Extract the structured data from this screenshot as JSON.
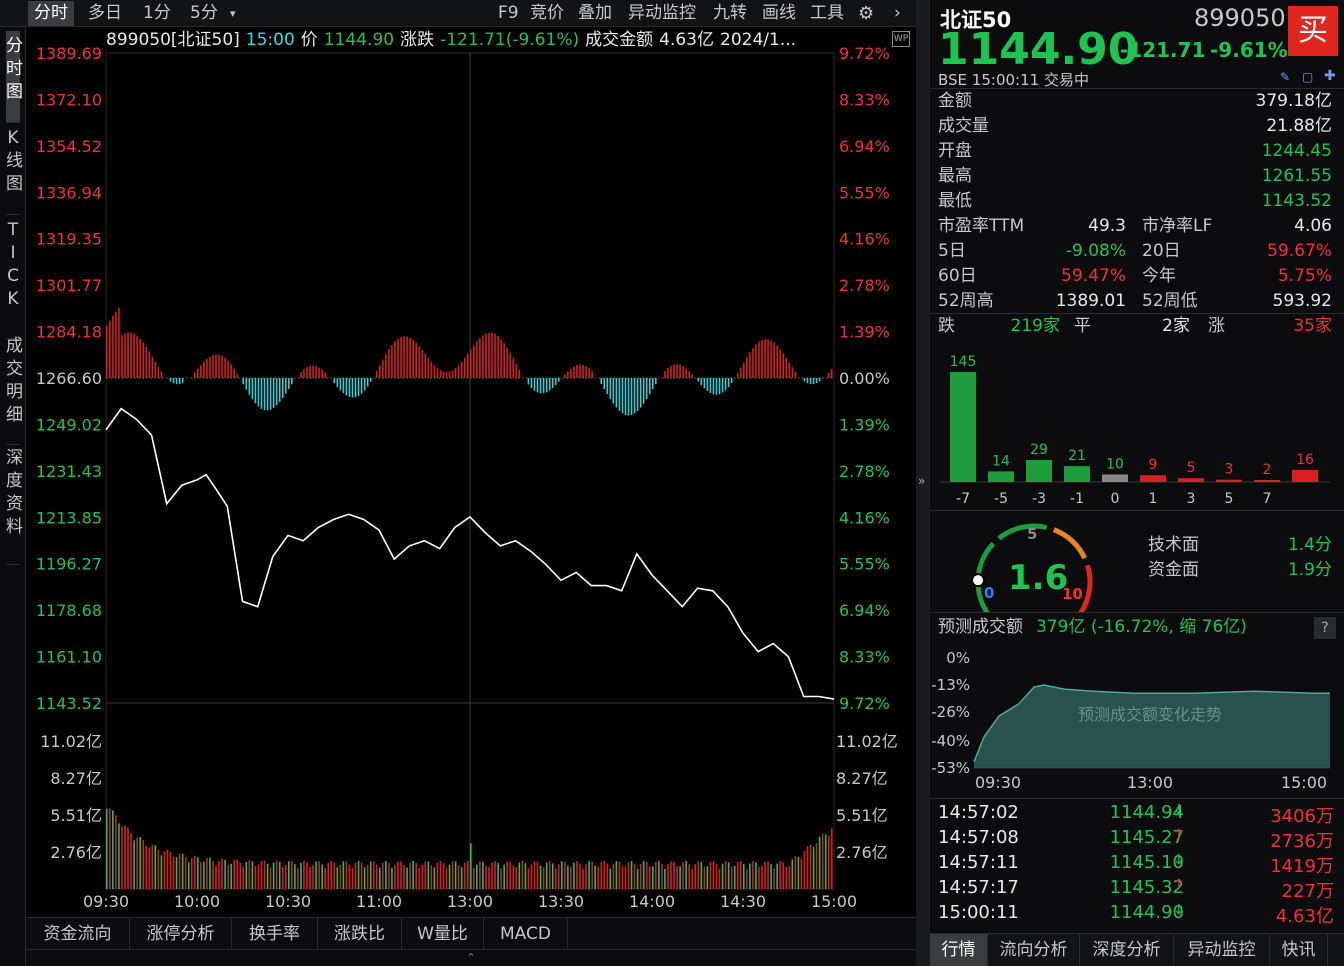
{
  "toolbar": {
    "tabs": [
      "分时",
      "多日",
      "1分",
      "5分"
    ],
    "tools": [
      "F9",
      "竞价",
      "叠加",
      "异动监控",
      "九转",
      "画线",
      "工具"
    ]
  },
  "left_tabs": [
    "分时图",
    "K线图",
    "TICK",
    "成交明细",
    "深度资料"
  ],
  "infobar": {
    "code": "899050[北证50]",
    "time": "15:00",
    "price_label": "价",
    "price": "1144.90",
    "change_label": "涨跌",
    "change": "-121.71(-9.61%)",
    "amount_label": "成交金额",
    "amount": "4.63亿",
    "date": "2024/1..."
  },
  "chart_data": {
    "type": "line",
    "title": "",
    "x_ticks": [
      "09:30",
      "10:00",
      "10:30",
      "11:00",
      "13:00",
      "13:30",
      "14:00",
      "14:30",
      "15:00"
    ],
    "price_ticks": [
      "1389.69",
      "1372.10",
      "1354.52",
      "1336.94",
      "1319.35",
      "1301.77",
      "1284.18",
      "1266.60",
      "1249.02",
      "1231.43",
      "1213.85",
      "1196.27",
      "1178.68",
      "1161.10",
      "1143.52"
    ],
    "pct_ticks": [
      "9.72%",
      "8.33%",
      "6.94%",
      "5.55%",
      "4.16%",
      "2.78%",
      "1.39%",
      "0.00%",
      "1.39%",
      "2.78%",
      "4.16%",
      "5.55%",
      "6.94%",
      "8.33%",
      "9.72%"
    ],
    "prev_close": 1266.6,
    "ylim": [
      1143.52,
      1389.69
    ],
    "volume_ticks": [
      "11.02亿",
      "8.27亿",
      "5.51亿",
      "2.76亿"
    ],
    "series": [
      {
        "x": [
          0,
          5,
          10,
          15,
          20,
          25,
          30,
          33,
          36,
          40,
          45,
          50,
          55,
          60,
          65,
          70,
          75,
          80,
          85,
          90,
          95,
          100,
          105,
          110,
          115,
          120,
          125,
          130,
          135,
          140,
          145,
          150,
          155,
          160,
          165,
          170,
          175,
          180,
          185,
          190,
          195,
          200,
          205,
          210,
          215,
          220,
          225,
          230,
          235,
          240
        ],
        "values": [
          1247,
          1255,
          1251,
          1245,
          1219,
          1226,
          1228,
          1230,
          1225,
          1218,
          1182,
          1180,
          1199,
          1207,
          1205,
          1210,
          1213,
          1215,
          1213,
          1209,
          1198,
          1203,
          1205,
          1202,
          1210,
          1214,
          1208,
          1203,
          1205,
          1201,
          1196,
          1190,
          1193,
          1188,
          1188,
          1186,
          1200,
          1192,
          1186,
          1180,
          1187,
          1186,
          1180,
          1170,
          1163,
          1166,
          1161,
          1146,
          1146,
          1145
        ]
      }
    ]
  },
  "quote": {
    "name": "北证50",
    "code": "899050",
    "price": "1144.90",
    "change": "-121.71",
    "change_pct": "-9.61%",
    "exchange": "BSE",
    "time": "15:00:11",
    "status": "交易中",
    "buy": "买"
  },
  "stats": [
    {
      "label": "金额",
      "value": "379.18亿",
      "color": "#e8e8e8"
    },
    {
      "label": "成交量",
      "value": "21.88亿",
      "color": "#e8e8e8"
    },
    {
      "label": "开盘",
      "value": "1244.45",
      "color": "#1ec452"
    },
    {
      "label": "最高",
      "value": "1261.55",
      "color": "#1ec452"
    },
    {
      "label": "最低",
      "value": "1143.52",
      "color": "#1ec452"
    }
  ],
  "stats2": [
    {
      "l1": "市盈率TTM",
      "v1": "49.3",
      "c1": "#e8e8e8",
      "l2": "市净率LF",
      "v2": "4.06",
      "c2": "#e8e8e8"
    },
    {
      "l1": "5日",
      "v1": "-9.08%",
      "c1": "#1ec452",
      "l2": "20日",
      "v2": "59.67%",
      "c2": "#f23030"
    },
    {
      "l1": "60日",
      "v1": "59.47%",
      "c1": "#f23030",
      "l2": "今年",
      "v2": "5.75%",
      "c2": "#f23030"
    },
    {
      "l1": "52周高",
      "v1": "1389.01",
      "c1": "#e8e8e8",
      "l2": "52周低",
      "v2": "593.92",
      "c2": "#e8e8e8"
    }
  ],
  "breadth": {
    "down_label": "跌",
    "down": "219家",
    "flat_label": "平",
    "flat": "2家",
    "up_label": "涨",
    "up": "35家"
  },
  "dist_chart": {
    "type": "bar",
    "categories": [
      "-7",
      "-5",
      "-3",
      "-1",
      "0",
      "1",
      "3",
      "5",
      "7",
      ""
    ],
    "x_ticks": [
      "-7",
      "-5",
      "-3",
      "-1",
      "0",
      "1",
      "3",
      "5",
      "7"
    ],
    "values": [
      145,
      14,
      29,
      21,
      10,
      9,
      5,
      3,
      2,
      16
    ]
  },
  "gauge": {
    "value": "1.6",
    "min": "0",
    "mid": "5",
    "max": "10",
    "tech_label": "技术面",
    "tech": "1.4分",
    "fund_label": "资金面",
    "fund": "1.9分"
  },
  "forecast": {
    "label": "预测成交额",
    "value": "379亿 (-16.72%, 缩 76亿)",
    "help": "?",
    "y_ticks": [
      "0%",
      "-13%",
      "-26%",
      "-40%",
      "-53%"
    ],
    "x_ticks": [
      "09:30",
      "13:00",
      "15:00"
    ],
    "watermark": "预测成交额变化走势"
  },
  "ticks": [
    {
      "time": "14:57:02",
      "price": "1144.94",
      "dir": "down",
      "vol": "3406万"
    },
    {
      "time": "14:57:08",
      "price": "1145.27",
      "dir": "up",
      "vol": "2736万"
    },
    {
      "time": "14:57:11",
      "price": "1145.10",
      "dir": "down",
      "vol": "1419万"
    },
    {
      "time": "14:57:17",
      "price": "1145.32",
      "dir": "up",
      "vol": "227万"
    },
    {
      "time": "15:00:11",
      "price": "1144.90",
      "dir": "down",
      "vol": "4.63亿"
    }
  ],
  "bottom_tabs": [
    "资金流向",
    "涨停分析",
    "换手率",
    "涨跌比",
    "W量比",
    "MACD"
  ],
  "right_tabs": [
    "行情",
    "流向分析",
    "深度分析",
    "异动监控",
    "快讯"
  ]
}
